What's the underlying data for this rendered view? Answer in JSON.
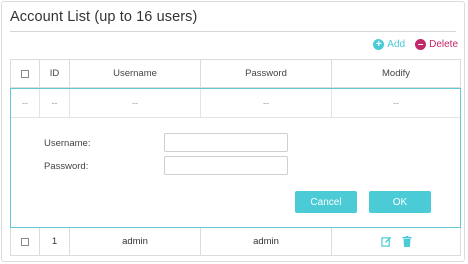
{
  "title": "Account List (up to 16 users)",
  "actions": {
    "add_label": "Add",
    "delete_label": "Delete"
  },
  "table": {
    "headers": {
      "id": "ID",
      "username": "Username",
      "password": "Password",
      "modify": "Modify"
    },
    "placeholder_row": {
      "id": "--",
      "username": "--",
      "password": "--",
      "modify": "--"
    },
    "rows": [
      {
        "id": "1",
        "username": "admin",
        "password": "admin"
      }
    ]
  },
  "form": {
    "username_label": "Username:",
    "password_label": "Password:",
    "username_value": "",
    "password_value": "",
    "cancel_label": "Cancel",
    "ok_label": "OK"
  },
  "colors": {
    "accent": "#4acbd6",
    "delete": "#c0296a",
    "border": "#dcdcdc"
  },
  "icons": {
    "add": "plus-circle-icon",
    "delete": "minus-circle-icon",
    "edit": "edit-icon",
    "trash": "trash-icon"
  }
}
